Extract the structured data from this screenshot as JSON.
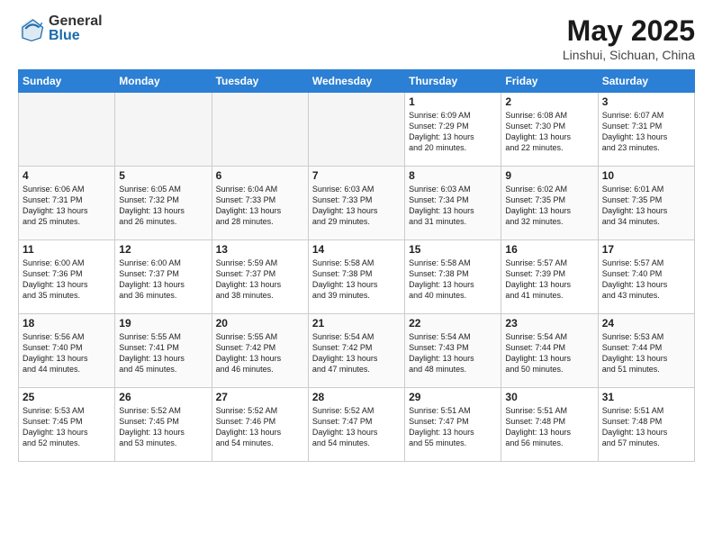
{
  "header": {
    "logo_general": "General",
    "logo_blue": "Blue",
    "title": "May 2025",
    "subtitle": "Linshui, Sichuan, China"
  },
  "weekdays": [
    "Sunday",
    "Monday",
    "Tuesday",
    "Wednesday",
    "Thursday",
    "Friday",
    "Saturday"
  ],
  "weeks": [
    [
      {
        "day": "",
        "info": ""
      },
      {
        "day": "",
        "info": ""
      },
      {
        "day": "",
        "info": ""
      },
      {
        "day": "",
        "info": ""
      },
      {
        "day": "1",
        "info": "Sunrise: 6:09 AM\nSunset: 7:29 PM\nDaylight: 13 hours\nand 20 minutes."
      },
      {
        "day": "2",
        "info": "Sunrise: 6:08 AM\nSunset: 7:30 PM\nDaylight: 13 hours\nand 22 minutes."
      },
      {
        "day": "3",
        "info": "Sunrise: 6:07 AM\nSunset: 7:31 PM\nDaylight: 13 hours\nand 23 minutes."
      }
    ],
    [
      {
        "day": "4",
        "info": "Sunrise: 6:06 AM\nSunset: 7:31 PM\nDaylight: 13 hours\nand 25 minutes."
      },
      {
        "day": "5",
        "info": "Sunrise: 6:05 AM\nSunset: 7:32 PM\nDaylight: 13 hours\nand 26 minutes."
      },
      {
        "day": "6",
        "info": "Sunrise: 6:04 AM\nSunset: 7:33 PM\nDaylight: 13 hours\nand 28 minutes."
      },
      {
        "day": "7",
        "info": "Sunrise: 6:03 AM\nSunset: 7:33 PM\nDaylight: 13 hours\nand 29 minutes."
      },
      {
        "day": "8",
        "info": "Sunrise: 6:03 AM\nSunset: 7:34 PM\nDaylight: 13 hours\nand 31 minutes."
      },
      {
        "day": "9",
        "info": "Sunrise: 6:02 AM\nSunset: 7:35 PM\nDaylight: 13 hours\nand 32 minutes."
      },
      {
        "day": "10",
        "info": "Sunrise: 6:01 AM\nSunset: 7:35 PM\nDaylight: 13 hours\nand 34 minutes."
      }
    ],
    [
      {
        "day": "11",
        "info": "Sunrise: 6:00 AM\nSunset: 7:36 PM\nDaylight: 13 hours\nand 35 minutes."
      },
      {
        "day": "12",
        "info": "Sunrise: 6:00 AM\nSunset: 7:37 PM\nDaylight: 13 hours\nand 36 minutes."
      },
      {
        "day": "13",
        "info": "Sunrise: 5:59 AM\nSunset: 7:37 PM\nDaylight: 13 hours\nand 38 minutes."
      },
      {
        "day": "14",
        "info": "Sunrise: 5:58 AM\nSunset: 7:38 PM\nDaylight: 13 hours\nand 39 minutes."
      },
      {
        "day": "15",
        "info": "Sunrise: 5:58 AM\nSunset: 7:38 PM\nDaylight: 13 hours\nand 40 minutes."
      },
      {
        "day": "16",
        "info": "Sunrise: 5:57 AM\nSunset: 7:39 PM\nDaylight: 13 hours\nand 41 minutes."
      },
      {
        "day": "17",
        "info": "Sunrise: 5:57 AM\nSunset: 7:40 PM\nDaylight: 13 hours\nand 43 minutes."
      }
    ],
    [
      {
        "day": "18",
        "info": "Sunrise: 5:56 AM\nSunset: 7:40 PM\nDaylight: 13 hours\nand 44 minutes."
      },
      {
        "day": "19",
        "info": "Sunrise: 5:55 AM\nSunset: 7:41 PM\nDaylight: 13 hours\nand 45 minutes."
      },
      {
        "day": "20",
        "info": "Sunrise: 5:55 AM\nSunset: 7:42 PM\nDaylight: 13 hours\nand 46 minutes."
      },
      {
        "day": "21",
        "info": "Sunrise: 5:54 AM\nSunset: 7:42 PM\nDaylight: 13 hours\nand 47 minutes."
      },
      {
        "day": "22",
        "info": "Sunrise: 5:54 AM\nSunset: 7:43 PM\nDaylight: 13 hours\nand 48 minutes."
      },
      {
        "day": "23",
        "info": "Sunrise: 5:54 AM\nSunset: 7:44 PM\nDaylight: 13 hours\nand 50 minutes."
      },
      {
        "day": "24",
        "info": "Sunrise: 5:53 AM\nSunset: 7:44 PM\nDaylight: 13 hours\nand 51 minutes."
      }
    ],
    [
      {
        "day": "25",
        "info": "Sunrise: 5:53 AM\nSunset: 7:45 PM\nDaylight: 13 hours\nand 52 minutes."
      },
      {
        "day": "26",
        "info": "Sunrise: 5:52 AM\nSunset: 7:45 PM\nDaylight: 13 hours\nand 53 minutes."
      },
      {
        "day": "27",
        "info": "Sunrise: 5:52 AM\nSunset: 7:46 PM\nDaylight: 13 hours\nand 54 minutes."
      },
      {
        "day": "28",
        "info": "Sunrise: 5:52 AM\nSunset: 7:47 PM\nDaylight: 13 hours\nand 54 minutes."
      },
      {
        "day": "29",
        "info": "Sunrise: 5:51 AM\nSunset: 7:47 PM\nDaylight: 13 hours\nand 55 minutes."
      },
      {
        "day": "30",
        "info": "Sunrise: 5:51 AM\nSunset: 7:48 PM\nDaylight: 13 hours\nand 56 minutes."
      },
      {
        "day": "31",
        "info": "Sunrise: 5:51 AM\nSunset: 7:48 PM\nDaylight: 13 hours\nand 57 minutes."
      }
    ]
  ]
}
